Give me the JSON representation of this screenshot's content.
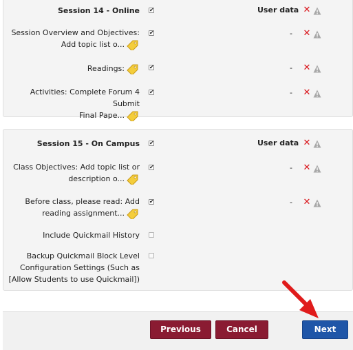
{
  "session14": {
    "title": "Session 14 - Online",
    "header_right": "User data",
    "items": [
      {
        "label_line1": "Session Overview and Objectives:",
        "label_line2": "Add topic list o...",
        "right": "-"
      },
      {
        "label_line1": "Readings:",
        "right": "-"
      },
      {
        "label_line1": "Activities: Complete Forum 4 Submit",
        "label_line2": "Final Pape...",
        "right": "-"
      }
    ]
  },
  "session15": {
    "title": "Session 15 - On Campus",
    "header_right": "User data",
    "items": [
      {
        "label_line1": "Class Objectives: Add topic list or",
        "label_line2": "description o...",
        "right": "-"
      },
      {
        "label_line1": "Before class, please read: Add",
        "label_line2": "reading assignment...",
        "right": "-"
      },
      {
        "label_line1": "Include Quickmail History"
      },
      {
        "label_line1": "Backup Quickmail Block Level",
        "label_line2": "Configuration Settings (Such as",
        "label_line3": "[Allow Students to use Quickmail])"
      }
    ]
  },
  "icons": {
    "check": "✔",
    "delete": "✕"
  },
  "footer": {
    "previous": "Previous",
    "cancel": "Cancel",
    "next": "Next"
  },
  "colors": {
    "maroon_button": "#8a1b32",
    "blue_button": "#1f56a8",
    "delete_icon": "#d9141a",
    "annotation_arrow": "#e01b1b"
  }
}
